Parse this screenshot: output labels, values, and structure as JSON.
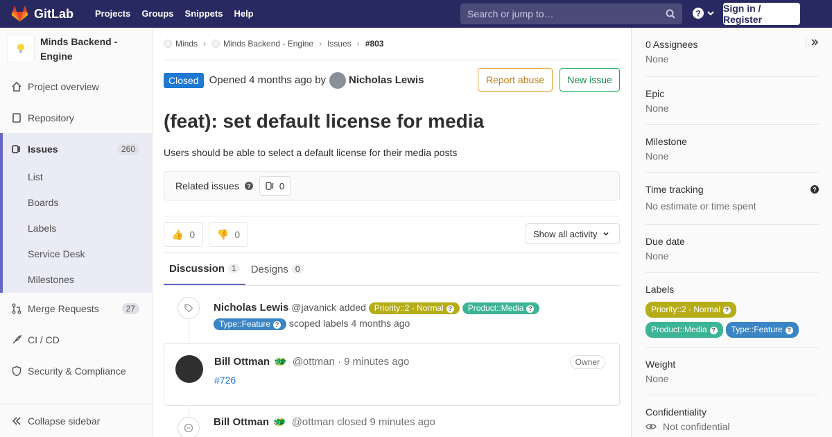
{
  "topbar": {
    "brand": "GitLab",
    "nav": [
      "Projects",
      "Groups",
      "Snippets",
      "Help"
    ],
    "search_placeholder": "Search or jump to…",
    "signin": "Sign in / Register"
  },
  "sidebar": {
    "project_name": "Minds Backend - Engine",
    "items": [
      {
        "label": "Project overview",
        "icon": "home-icon"
      },
      {
        "label": "Repository",
        "icon": "doc-icon"
      },
      {
        "label": "Issues",
        "icon": "issues-icon",
        "count": "260"
      },
      {
        "label": "Merge Requests",
        "icon": "merge-icon",
        "count": "27"
      },
      {
        "label": "CI / CD",
        "icon": "rocket-icon"
      },
      {
        "label": "Security & Compliance",
        "icon": "shield-icon"
      }
    ],
    "issue_subitems": [
      "List",
      "Boards",
      "Labels",
      "Service Desk",
      "Milestones"
    ],
    "collapse": "Collapse sidebar"
  },
  "breadcrumb": [
    "Minds",
    "Minds Backend - Engine",
    "Issues",
    "#803"
  ],
  "issue": {
    "status": "Closed",
    "opened_text": "Opened 4 months ago by",
    "author": "Nicholas Lewis",
    "report_abuse": "Report abuse",
    "new_issue": "New issue",
    "title": "(feat): set default license for media",
    "description": "Users should be able to select a default license for their media posts",
    "related_label": "Related issues",
    "related_count": "0",
    "thumbs_up": "0",
    "thumbs_down": "0",
    "show_activity": "Show all activity"
  },
  "tabs": [
    {
      "label": "Discussion",
      "count": "1"
    },
    {
      "label": "Designs",
      "count": "0"
    }
  ],
  "activity": {
    "label_note": {
      "author": "Nicholas Lewis",
      "handle": "@javanick added",
      "labels": [
        "Priority::2 - Normal",
        "Product::Media",
        "Type::Feature"
      ],
      "suffix": "scoped labels 4 months ago"
    },
    "comment": {
      "author": "Bill Ottman",
      "meta": "@ottman · 9 minutes ago",
      "role": "Owner",
      "body": "#726"
    },
    "closed_note": {
      "author": "Bill Ottman",
      "text": "@ottman closed 9 minutes ago"
    }
  },
  "right_sidebar": {
    "assignees_title": "0 Assignees",
    "assignees_value": "None",
    "epic_title": "Epic",
    "epic_value": "None",
    "milestone_title": "Milestone",
    "milestone_value": "None",
    "time_title": "Time tracking",
    "time_value": "No estimate or time spent",
    "due_title": "Due date",
    "due_value": "None",
    "labels_title": "Labels",
    "weight_title": "Weight",
    "weight_value": "None",
    "conf_title": "Confidentiality",
    "conf_value": "Not confidential"
  },
  "colors": {
    "navbar": "#292961",
    "priority": "#b5ad18",
    "media": "#3cb496",
    "feature": "#3b85c4",
    "closed": "#1f78d1"
  }
}
